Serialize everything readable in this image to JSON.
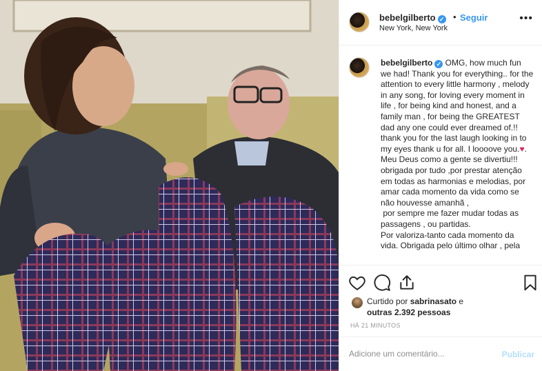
{
  "post": {
    "username": "bebelgilberto",
    "verified_mark": "✓",
    "dot": "•",
    "follow_label": "Seguir",
    "location": "New York, New York",
    "more_icon": "more-horizontal-icon",
    "more_glyph": "•••"
  },
  "caption": {
    "username": "bebelgilberto",
    "text_part1": " OMG, how much fun we had! Thank you for everything.. for the attention to every little harmony , melody in any song, for loving every moment in life , for being kind and honest, and a family man , for being the GREATEST dad any one could ever dreamed of.!! thank you for the last laugh looking in to my eyes thank u for all. I loooove you.",
    "heart": "♥",
    "text_part2": ". Meu Deus como a gente se divertiu!!!\nobrigada por tudo ,por prestar atenção em todas as harmonias e melodias, por amar cada momento da vida como se não houvesse amanhã ,\n por sempre me fazer mudar todas as passagens , ou partidas.\nPor valoriza-tanto cada momento da vida. Obrigada pelo último olhar , pela"
  },
  "likes": {
    "prefix": "Curtido por ",
    "liker": "sabrinasato",
    "middle": " e ",
    "others": "outras 2.392 pessoas"
  },
  "time": "HÁ 21 MINUTOS",
  "comment": {
    "placeholder": "Adicione um comentário...",
    "publish_label": "Publicar"
  },
  "colors": {
    "accent": "#3897f0",
    "publish_disabled": "#b2dffc",
    "text": "#262626",
    "muted": "#8e8e8e"
  }
}
